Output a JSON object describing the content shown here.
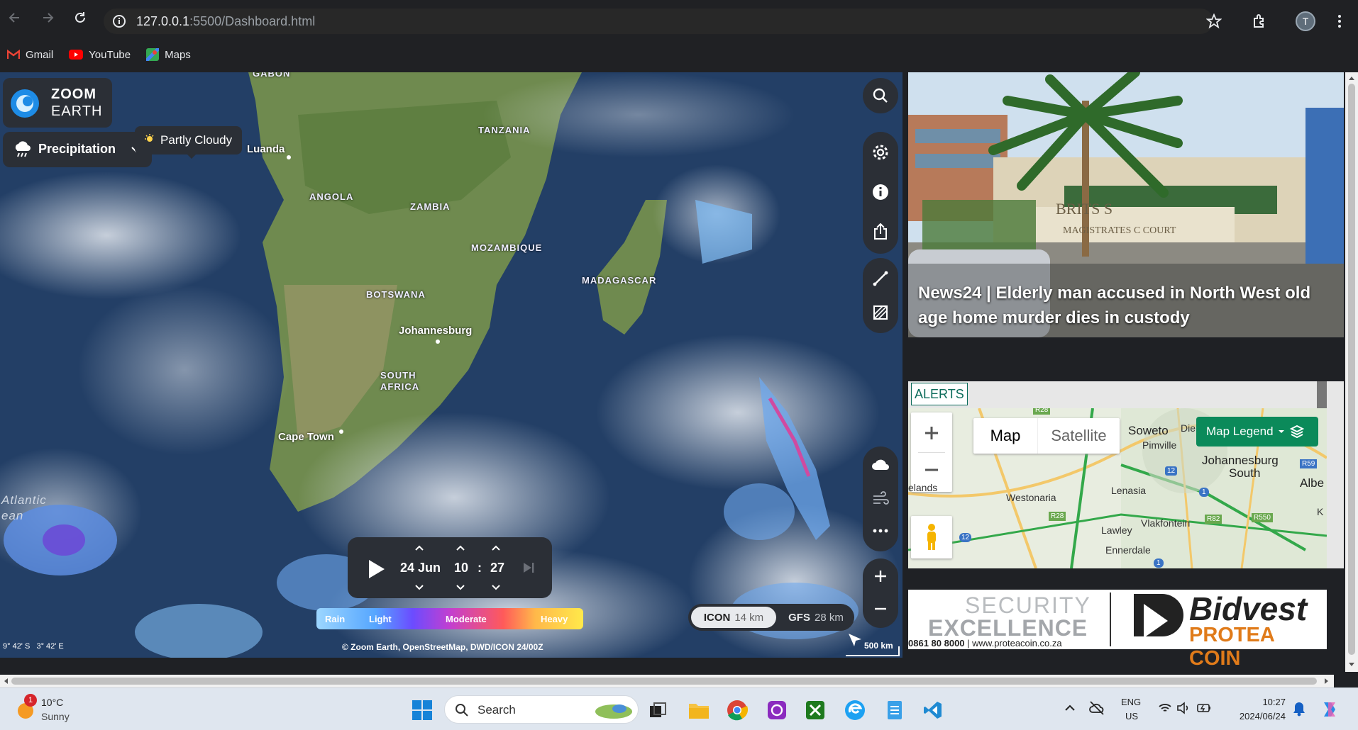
{
  "browser": {
    "url_host": "127.0.0.1",
    "url_rest": ":5500/Dashboard.html",
    "profile_initial": "T",
    "bookmarks": [
      {
        "label": "Gmail",
        "icon": "gmail-icon"
      },
      {
        "label": "YouTube",
        "icon": "youtube-icon"
      },
      {
        "label": "Maps",
        "icon": "maps-icon"
      }
    ]
  },
  "map": {
    "logo_line1": "ZOOM",
    "logo_line2": "EARTH",
    "layer": "Precipitation",
    "tooltip": "Partly Cloudy",
    "countries": [
      "GABON",
      "TANZANIA",
      "ANGOLA",
      "ZAMBIA",
      "MOZAMBIQUE",
      "MADAGASCAR",
      "BOTSWANA",
      "SOUTH",
      "AFRICA"
    ],
    "cities": [
      "Luanda",
      "Johannesburg",
      "Cape Town"
    ],
    "ocean": [
      "Atlantic",
      "ean"
    ],
    "time": {
      "date": "24 Jun",
      "hour": "10",
      "sep": ":",
      "minute": "27"
    },
    "legend": [
      "Rain",
      "Light",
      "Moderate",
      "Heavy"
    ],
    "models": [
      {
        "name": "ICON",
        "res": "14 km"
      },
      {
        "name": "GFS",
        "res": "28 km"
      }
    ],
    "coords": "9° 42' S   3° 42' E",
    "attribution": "© Zoom Earth, OpenStreetMap, DWD/ICON 24/00Z",
    "scale": "500 km"
  },
  "news": {
    "headline": "News24 | Elderly man accused in North West old age home murder dies in custody",
    "sign_line1": "BRITS S",
    "sign_line2": "MAGISTRATES C COURT"
  },
  "alerts": {
    "tab": "ALERTS",
    "map_btn": "Map",
    "satellite_btn": "Satellite",
    "legend_btn": "Map Legend",
    "places": [
      "Soweto",
      "Pimville",
      "Die",
      "Johannesburg",
      "South",
      "Albe",
      "elands",
      "Westonaria",
      "Lenasia",
      "Vlakfontein",
      "Lawley",
      "Ennerdale",
      "K"
    ],
    "roads": [
      "R28",
      "12",
      "R59",
      "1",
      "R28",
      "R82",
      "R550",
      "12",
      "1"
    ]
  },
  "ad": {
    "line1": "SECURITY",
    "line2": "EXCELLENCE",
    "contact_num": "0861 80 8000",
    "contact_web": " | www.proteacoin.co.za",
    "brand1": "Bidvest",
    "brand2": "PROTEA COIN"
  },
  "taskbar": {
    "weather_temp": "10°C",
    "weather_desc": "Sunny",
    "weather_badge": "1",
    "search": "Search",
    "lang1": "ENG",
    "lang2": "US",
    "time": "10:27",
    "date": "2024/06/24"
  },
  "colors": {
    "chrome_bg": "#202124",
    "map_ocean": "#24456e",
    "panel_dark": "#2b2f36",
    "news_bg": "#1f2125",
    "gmap_green": "#0b8a5a"
  }
}
